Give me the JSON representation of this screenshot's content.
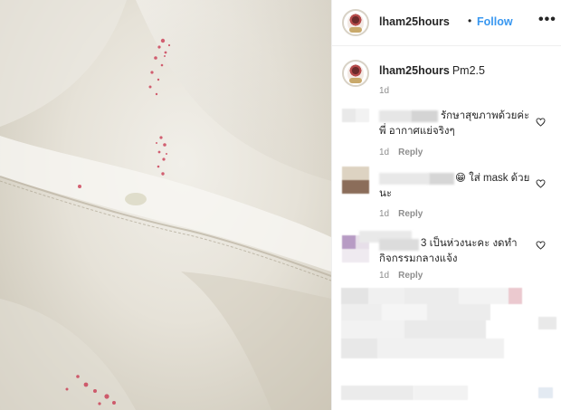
{
  "post": {
    "username": "lham25hours",
    "separator": "•",
    "follow_label": "Follow",
    "more_label": "•••"
  },
  "caption": {
    "username": "lham25hours",
    "text": "Pm2.5",
    "time": "1d"
  },
  "comments": [
    {
      "text": "รักษาสุขภาพด้วยค่ะพี่ อากาศแย่จริงๆ",
      "time": "1d",
      "reply_label": "Reply"
    },
    {
      "text": "😁 ใส่ mask ด้วยนะ",
      "time": "1d",
      "reply_label": "Reply"
    },
    {
      "text": "3 เป็นห่วงนะคะ งดทำกิจกรรมกลางแจ้ง",
      "time": "1d",
      "reply_label": "Reply"
    }
  ],
  "colors": {
    "link": "#3897f0",
    "meta": "#8e8e8e",
    "text": "#262626",
    "divider": "#efefef"
  }
}
